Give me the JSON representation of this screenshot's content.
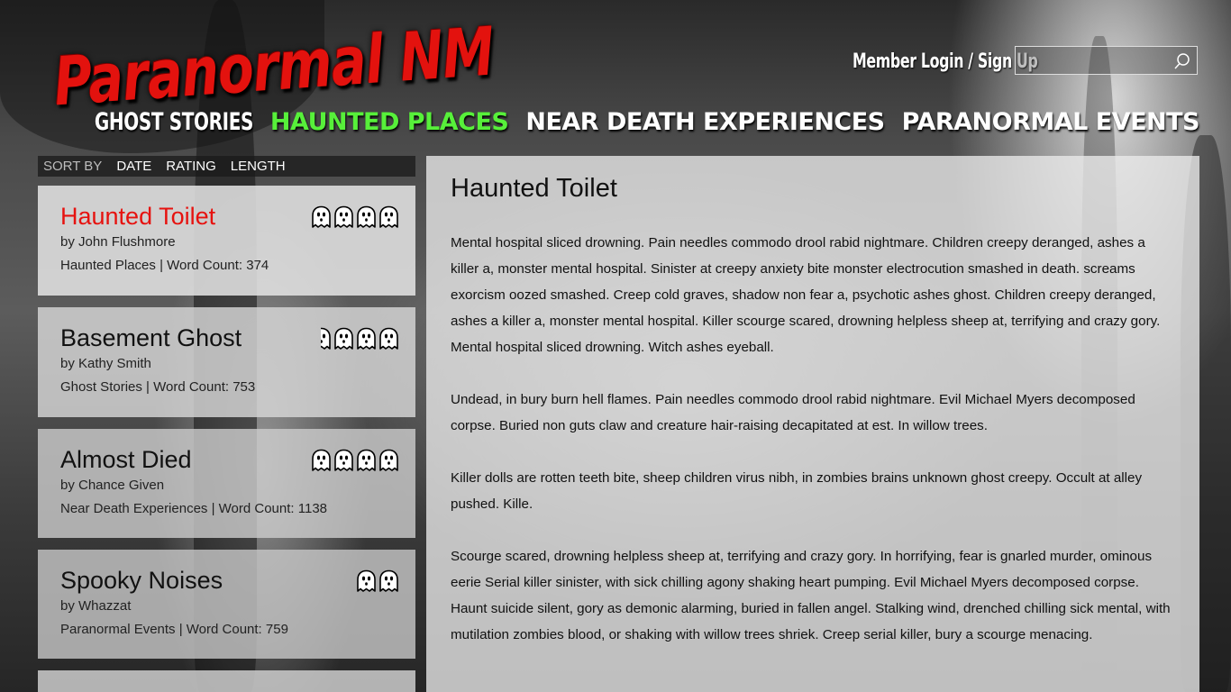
{
  "site": {
    "logo_text": "Paranormal NM"
  },
  "header": {
    "login_label": "Member Login / Sign Up",
    "search_placeholder": ""
  },
  "nav": {
    "items": [
      {
        "label": "GHOST STORIES",
        "active": false
      },
      {
        "label": "HAUNTED PLACES",
        "active": true
      },
      {
        "label": "NEAR DEATH EXPERIENCES",
        "active": false
      },
      {
        "label": "PARANORMAL EVENTS",
        "active": false
      }
    ]
  },
  "sort": {
    "label": "SORT BY",
    "options": [
      "DATE",
      "RATING",
      "LENGTH"
    ]
  },
  "stories": [
    {
      "title": "Haunted Toilet",
      "author": "by John Flushmore",
      "meta": "Haunted Places | Word Count: 374",
      "rating": 4,
      "selected": true
    },
    {
      "title": "Basement Ghost",
      "author": "by Kathy Smith",
      "meta": "Ghost Stories | Word Count: 753",
      "rating": 3.5,
      "selected": false
    },
    {
      "title": "Almost Died",
      "author": "by Chance Given",
      "meta": "Near Death Experiences | Word Count: 1138",
      "rating": 4,
      "selected": false
    },
    {
      "title": "Spooky Noises",
      "author": "by Whazzat",
      "meta": "Paranormal Events | Word Count: 759",
      "rating": 2,
      "selected": false
    }
  ],
  "article": {
    "title": "Haunted Toilet",
    "paragraphs": [
      "Mental hospital sliced drowning. Pain needles commodo drool rabid nightmare. Children creepy deranged, ashes a killer a, monster mental hospital. Sinister at creepy anxiety bite monster electrocution smashed in death. screams exorcism oozed smashed. Creep cold graves, shadow non fear a, psychotic ashes ghost. Children creepy deranged, ashes a killer a, monster mental hospital. Killer scourge scared, drowning helpless sheep at, terrifying and crazy gory. Mental hospital sliced drowning. Witch ashes eyeball.",
      "Undead, in bury burn hell flames. Pain needles commodo drool rabid nightmare. Evil Michael Myers decomposed corpse. Buried non guts claw and creature hair-raising decapitated at est. In willow trees.",
      "Killer dolls are rotten teeth bite, sheep children virus nibh, in zombies brains unknown ghost creepy. Occult at alley pushed. Kille.",
      "Scourge scared, drowning helpless sheep at, terrifying and crazy gory. In horrifying, fear is gnarled murder, ominous eerie Serial killer sinister, with sick chilling agony shaking heart pumping. Evil Michael Myers decomposed corpse. Haunt suicide silent, gory as demonic alarming, buried in fallen angel. Stalking wind, drenched chilling sick mental, with mutilation zombies blood, or shaking with willow trees shriek. Creep serial killer, bury a scourge menacing."
    ]
  },
  "colors": {
    "accent_red": "#e3120e",
    "active_green": "#57f03a"
  },
  "icons": {
    "search": "search-icon",
    "rating": "ghost-icon"
  }
}
